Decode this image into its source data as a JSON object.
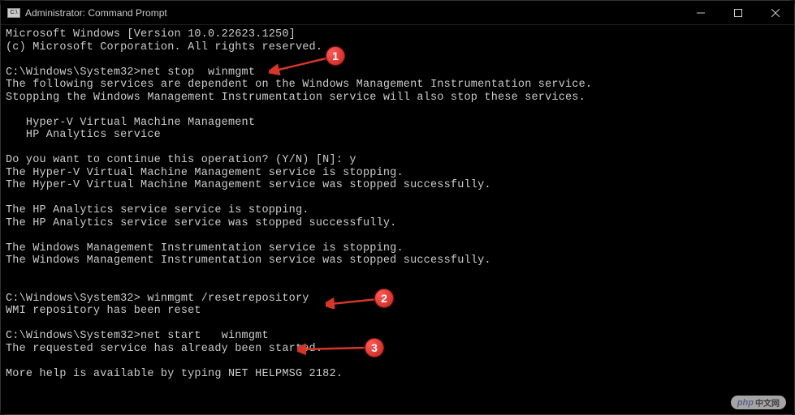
{
  "window": {
    "title": "Administrator: Command Prompt",
    "icon_label": "C:\\"
  },
  "terminal": {
    "line1": "Microsoft Windows [Version 10.0.22623.1250]",
    "line2": "(c) Microsoft Corporation. All rights reserved.",
    "blank1": "",
    "prompt1": "C:\\Windows\\System32>net stop  winmgmt",
    "dep1": "The following services are dependent on the Windows Management Instrumentation service.",
    "dep2": "Stopping the Windows Management Instrumentation service will also stop these services.",
    "blank2": "",
    "svc1": "   Hyper-V Virtual Machine Management",
    "svc2": "   HP Analytics service",
    "blank3": "",
    "confirm": "Do you want to continue this operation? (Y/N) [N]: y",
    "hv1": "The Hyper-V Virtual Machine Management service is stopping.",
    "hv2": "The Hyper-V Virtual Machine Management service was stopped successfully.",
    "blank4": "",
    "hp1": "The HP Analytics service service is stopping.",
    "hp2": "The HP Analytics service service was stopped successfully.",
    "blank5": "",
    "wmi1": "The Windows Management Instrumentation service is stopping.",
    "wmi2": "The Windows Management Instrumentation service was stopped successfully.",
    "blank6": "",
    "blank7": "",
    "prompt2": "C:\\Windows\\System32> winmgmt /resetrepository",
    "reset": "WMI repository has been reset",
    "blank8": "",
    "prompt3": "C:\\Windows\\System32>net start   winmgmt",
    "started": "The requested service has already been started.",
    "blank9": "",
    "help": "More help is available by typing NET HELPMSG 2182."
  },
  "callouts": {
    "c1": "1",
    "c2": "2",
    "c3": "3"
  },
  "watermark": {
    "brand": "php",
    "text": "中文网"
  }
}
